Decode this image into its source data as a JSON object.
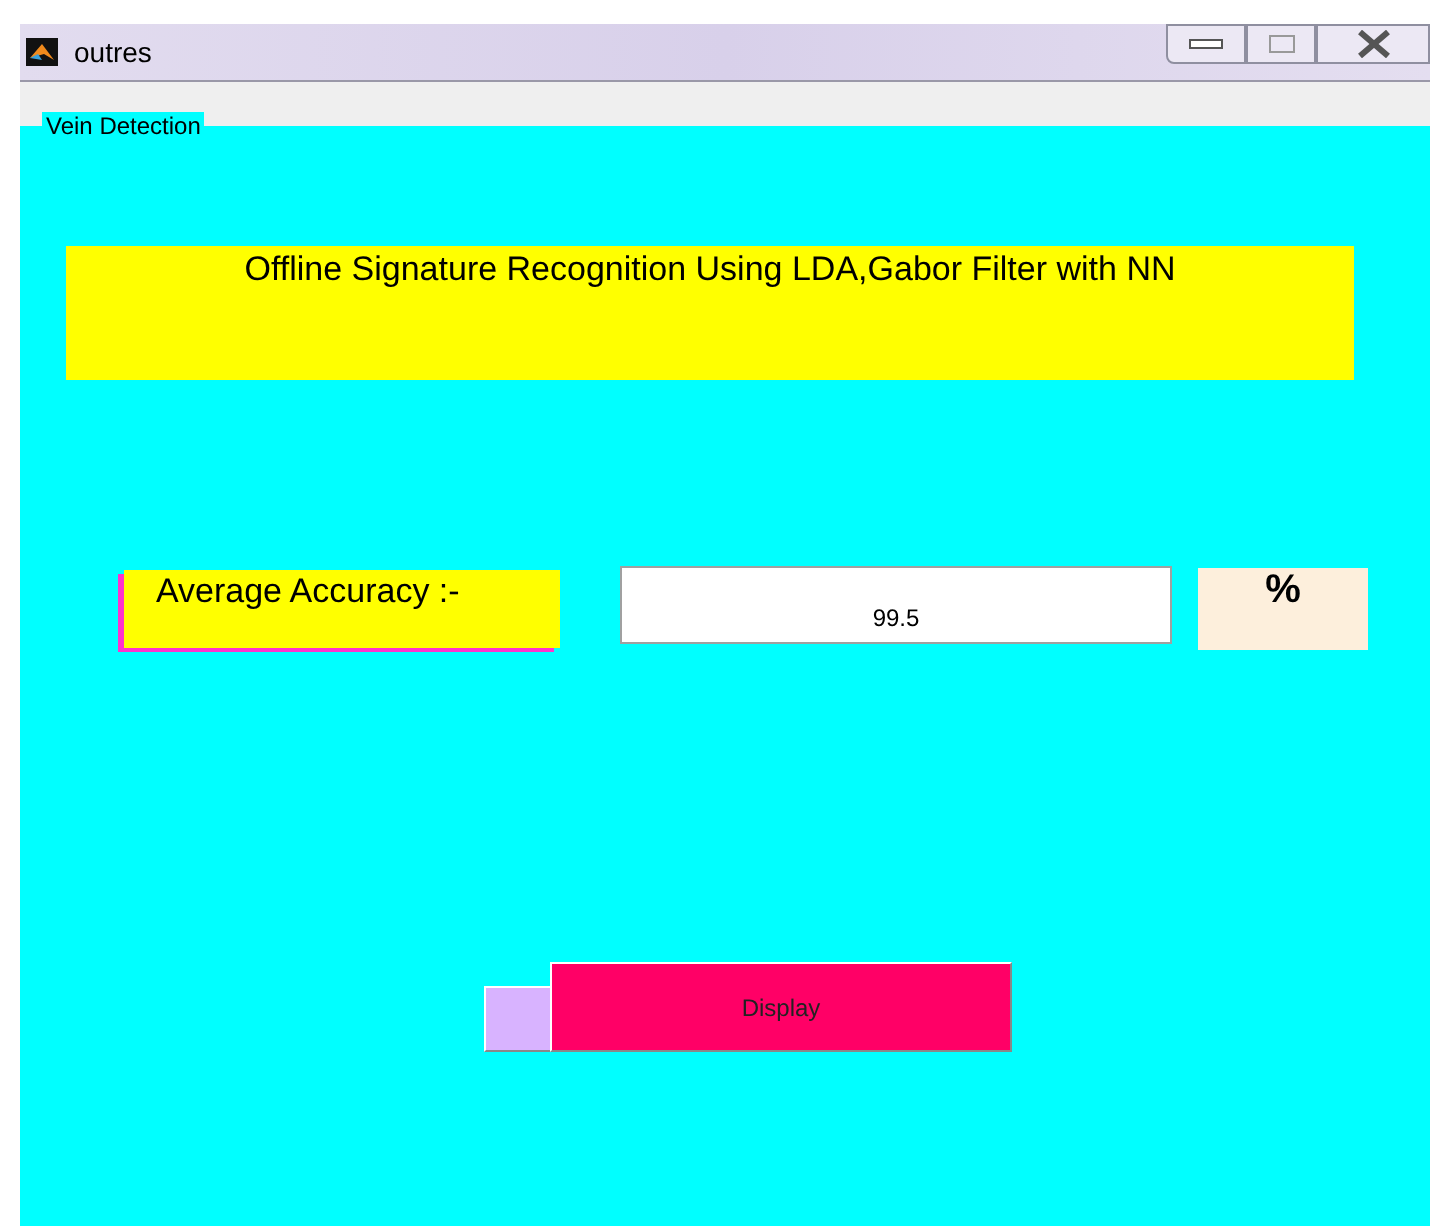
{
  "window": {
    "title": "outres"
  },
  "panel": {
    "title": "Vein Detection"
  },
  "heading": "Offline Signature Recognition Using LDA,Gabor Filter with NN",
  "accuracy": {
    "label": "Average Accuracy :-",
    "value": "99.5",
    "unit": "%"
  },
  "buttons": [
    {
      "kind": "blank"
    },
    {
      "kind": "labeled",
      "label": "Display"
    }
  ]
}
